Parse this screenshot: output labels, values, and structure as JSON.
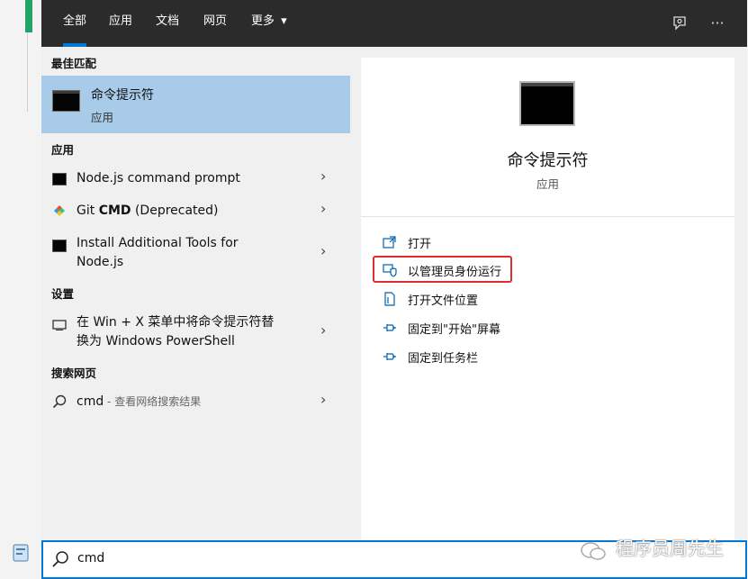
{
  "tabs": [
    {
      "label": "全部"
    },
    {
      "label": "应用"
    },
    {
      "label": "文档"
    },
    {
      "label": "网页"
    },
    {
      "label": "更多"
    }
  ],
  "more_arrow": "▾",
  "top_icons": {
    "feedback": "feedback-icon",
    "more": "···"
  },
  "best_match": {
    "section": "最佳匹配",
    "title": "命令提示符",
    "subtitle": "应用"
  },
  "apps_section": "应用",
  "apps": [
    {
      "label": "Node.js command prompt"
    },
    {
      "label_prefix": "Git ",
      "label_bold": "CMD",
      "label_suffix": " (Deprecated)"
    },
    {
      "line1": "Install Additional Tools for",
      "line2": "Node.js"
    }
  ],
  "settings_section": "设置",
  "settings": [
    {
      "line1": "在 Win + X 菜单中将命令提示符替",
      "line2": "换为 Windows PowerShell"
    }
  ],
  "web_section": "搜索网页",
  "web": [
    {
      "query": "cmd",
      "suffix": " - 查看网络搜索结果"
    }
  ],
  "chevron": "›",
  "details": {
    "title": "命令提示符",
    "subtitle": "应用",
    "actions": [
      {
        "label": "打开",
        "icon": "open-icon"
      },
      {
        "label": "以管理员身份运行",
        "icon": "shield-admin-icon"
      },
      {
        "label": "打开文件位置",
        "icon": "file-location-icon"
      },
      {
        "label": "固定到\"开始\"屏幕",
        "icon": "pin-icon"
      },
      {
        "label": "固定到任务栏",
        "icon": "pin-icon"
      }
    ]
  },
  "search": {
    "value": "cmd"
  },
  "watermark": "程序员周先生",
  "colors": {
    "accent": "#0078d7",
    "selected": "#a7cbe9",
    "highlight_border": "#d9302c",
    "topbar": "#2b2b2b"
  }
}
